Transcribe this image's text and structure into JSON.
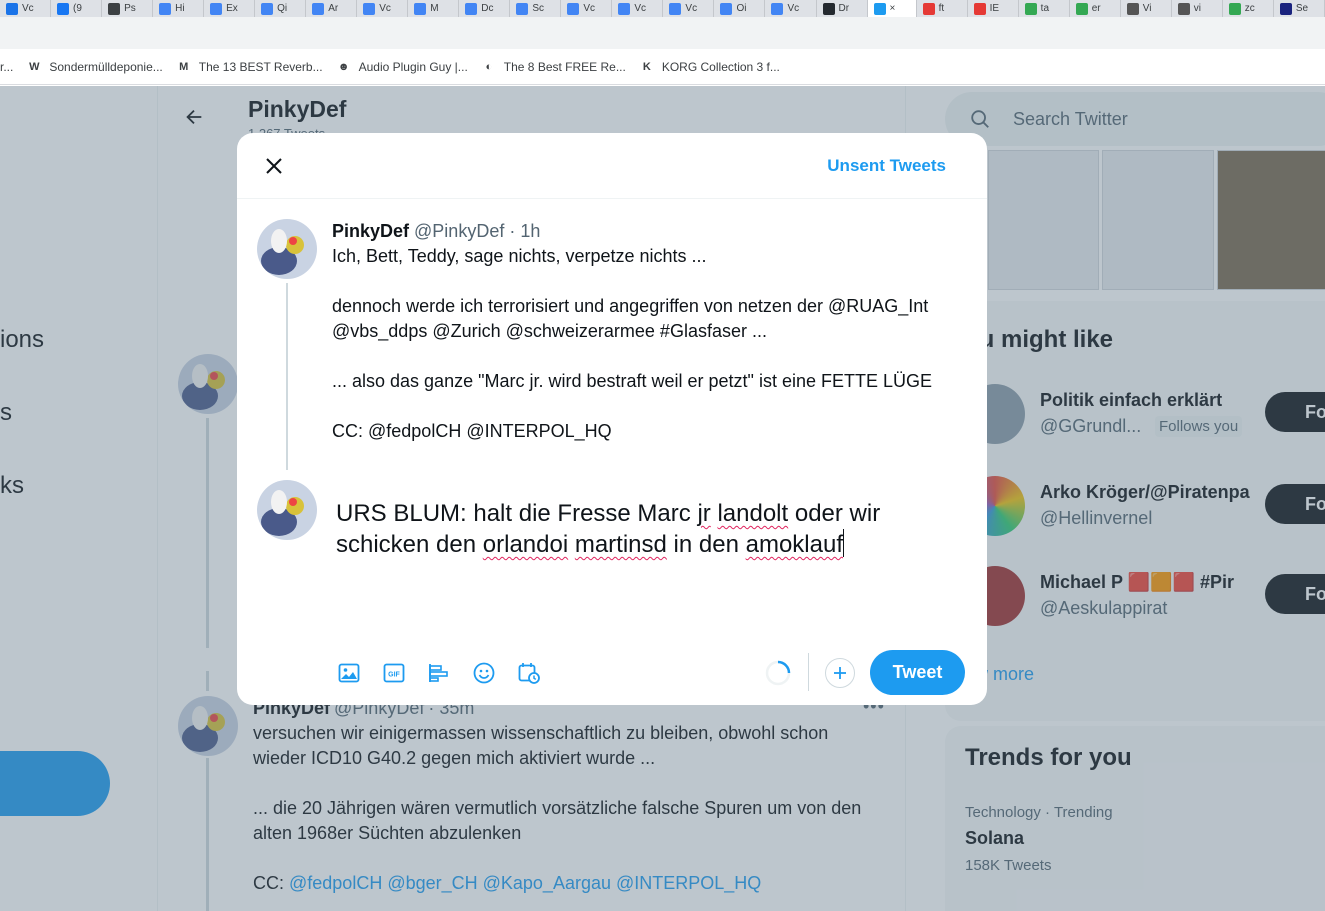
{
  "browser": {
    "tabs": [
      {
        "label": "Vc",
        "color": "#1a73e8"
      },
      {
        "label": "(9",
        "color": "#1877f2"
      },
      {
        "label": "Ps",
        "color": "#3c4043"
      },
      {
        "label": "Hi",
        "color": "#4285f4"
      },
      {
        "label": "Ex",
        "color": "#4285f4"
      },
      {
        "label": "Qi",
        "color": "#4285f4"
      },
      {
        "label": "Ar",
        "color": "#4285f4"
      },
      {
        "label": "Vc",
        "color": "#4285f4"
      },
      {
        "label": "M",
        "color": "#4285f4"
      },
      {
        "label": "Dc",
        "color": "#4285f4"
      },
      {
        "label": "Sc",
        "color": "#4285f4"
      },
      {
        "label": "Vc",
        "color": "#4285f4"
      },
      {
        "label": "Vc",
        "color": "#4285f4"
      },
      {
        "label": "Vc",
        "color": "#4285f4"
      },
      {
        "label": "Oi",
        "color": "#4285f4"
      },
      {
        "label": "Vc",
        "color": "#4285f4"
      },
      {
        "label": "Dr",
        "color": "#24292f"
      },
      {
        "label": "×",
        "color": "#1d9bf0"
      },
      {
        "label": "ft",
        "color": "#e53935"
      },
      {
        "label": "IE",
        "color": "#e53935"
      },
      {
        "label": "ta",
        "color": "#34a853"
      },
      {
        "label": "er",
        "color": "#34a853"
      },
      {
        "label": "Vi",
        "color": "#555"
      },
      {
        "label": "vi",
        "color": "#555"
      },
      {
        "label": "zc",
        "color": "#34a853"
      },
      {
        "label": "Se",
        "color": "#1a237e"
      }
    ],
    "bookmarks": [
      {
        "label": "r...",
        "icon": ""
      },
      {
        "label": "Sondermülldeponie...",
        "icon": "W"
      },
      {
        "label": "The 13 BEST Reverb...",
        "icon": "M"
      },
      {
        "label": "Audio Plugin Guy |...",
        "icon": "☻"
      },
      {
        "label": "The 8 Best FREE Re...",
        "icon": "◐"
      },
      {
        "label": "KORG Collection 3 f...",
        "icon": "K"
      }
    ]
  },
  "sidebar": {
    "items": [
      {
        "label": "ions"
      },
      {
        "label": "s"
      },
      {
        "label": "ks"
      }
    ]
  },
  "profile": {
    "name": "PinkyDef",
    "tweet_count": "1,267 Tweets"
  },
  "timeline_tweet": {
    "name": "PinkyDef",
    "handle": "@PinkyDef",
    "time": "· 35m",
    "more": "•••",
    "lines": [
      "versuchen wir einigermassen wissenschaftlich zu bleiben, obwohl schon",
      "wieder ICD10 G40.2 gegen mich aktiviert wurde ..."
    ],
    "lines2": [
      "... die 20 Jährigen wären vermutlich vorsätzliche falsche Spuren um von den",
      "alten 1968er Süchten abzulenken"
    ],
    "cc_prefix": "CC: ",
    "cc_mentions": "@fedpolCH @bger_CH @Kapo_Aargau @INTERPOL_HQ"
  },
  "search": {
    "placeholder": "Search Twitter"
  },
  "who_to_follow": {
    "title": "ou might like",
    "users": [
      {
        "name": "Politik einfach erklärt",
        "handle": "@GGrundl...",
        "follows_you": "Follows you",
        "follow": "Follo",
        "color": "#8a9ba8"
      },
      {
        "name": "Arko Kröger/@Piratenpa",
        "handle": "@Hellinvernel",
        "follows_you": "",
        "follow": "Follo",
        "color": "#c0392b"
      },
      {
        "name": "Michael P 🟥🟧🟥 #Pir",
        "handle": "@Aeskulappirat",
        "follows_you": "",
        "follow": "Follo",
        "color": "#a03030"
      }
    ],
    "show_more": "ow more"
  },
  "trends": {
    "title": "Trends for you",
    "meta": "Technology · Trending",
    "name": "Solana",
    "count": "158K Tweets"
  },
  "modal": {
    "unsent_label": "Unsent Tweets",
    "reply": {
      "name": "PinkyDef",
      "handle": "@PinkyDef",
      "time": "· 1h",
      "p1": [
        "Ich, Bett, Teddy, sage nichts, verpetze nichts ..."
      ],
      "p2": [
        "dennoch werde ich terrorisiert und angegriffen von netzen der @RUAG_Int",
        "@vbs_ddps @Zurich @schweizerarmee #Glasfaser ..."
      ],
      "p3": [
        "... also das ganze \"Marc jr. wird bestraft weil er petzt\" ist eine FETTE LÜGE"
      ],
      "p4": [
        "CC: @fedpolCH @INTERPOL_HQ"
      ]
    },
    "compose": {
      "seg1": "URS BLUM: halt die Fresse Marc ",
      "w1": "jr",
      "seg2": " ",
      "w2": "landolt",
      "seg3": " oder wir",
      "seg4": "schicken den ",
      "w3": "orlandoi",
      "seg5": " ",
      "w4": "martinsd",
      "seg6": " in den ",
      "w5": "amoklauf"
    },
    "toolbar": {
      "icons": [
        "image-icon",
        "gif-icon",
        "poll-icon",
        "emoji-icon",
        "schedule-icon"
      ],
      "accent": "#1d9bf0"
    },
    "tweet_label": "Tweet"
  }
}
